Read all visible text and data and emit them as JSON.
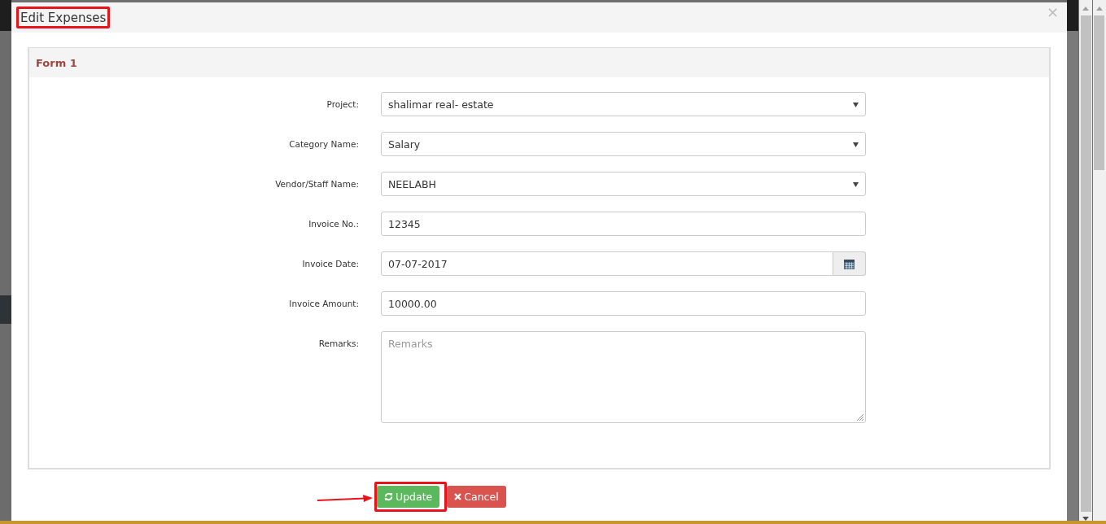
{
  "modal": {
    "title": "Edit Expenses",
    "close": "×",
    "panel": {
      "title": "Form 1",
      "fields": [
        {
          "kind": "select",
          "label": "Project:",
          "value": "shalimar real- estate"
        },
        {
          "kind": "select",
          "label": "Category Name:",
          "value": "Salary"
        },
        {
          "kind": "select",
          "label": "Vendor/Staff Name:",
          "value": "NEELABH"
        },
        {
          "kind": "text",
          "label": "Invoice No.:",
          "value": "12345"
        },
        {
          "kind": "date",
          "label": "Invoice Date:",
          "value": "07-07-2017"
        },
        {
          "kind": "text",
          "label": "Invoice Amount:",
          "value": "10000.00"
        },
        {
          "kind": "textarea",
          "label": "Remarks:",
          "placeholder": "Remarks"
        }
      ]
    },
    "buttons": [
      {
        "kind": "update",
        "label": "Update"
      },
      {
        "kind": "cancel",
        "label": "Cancel"
      }
    ]
  }
}
